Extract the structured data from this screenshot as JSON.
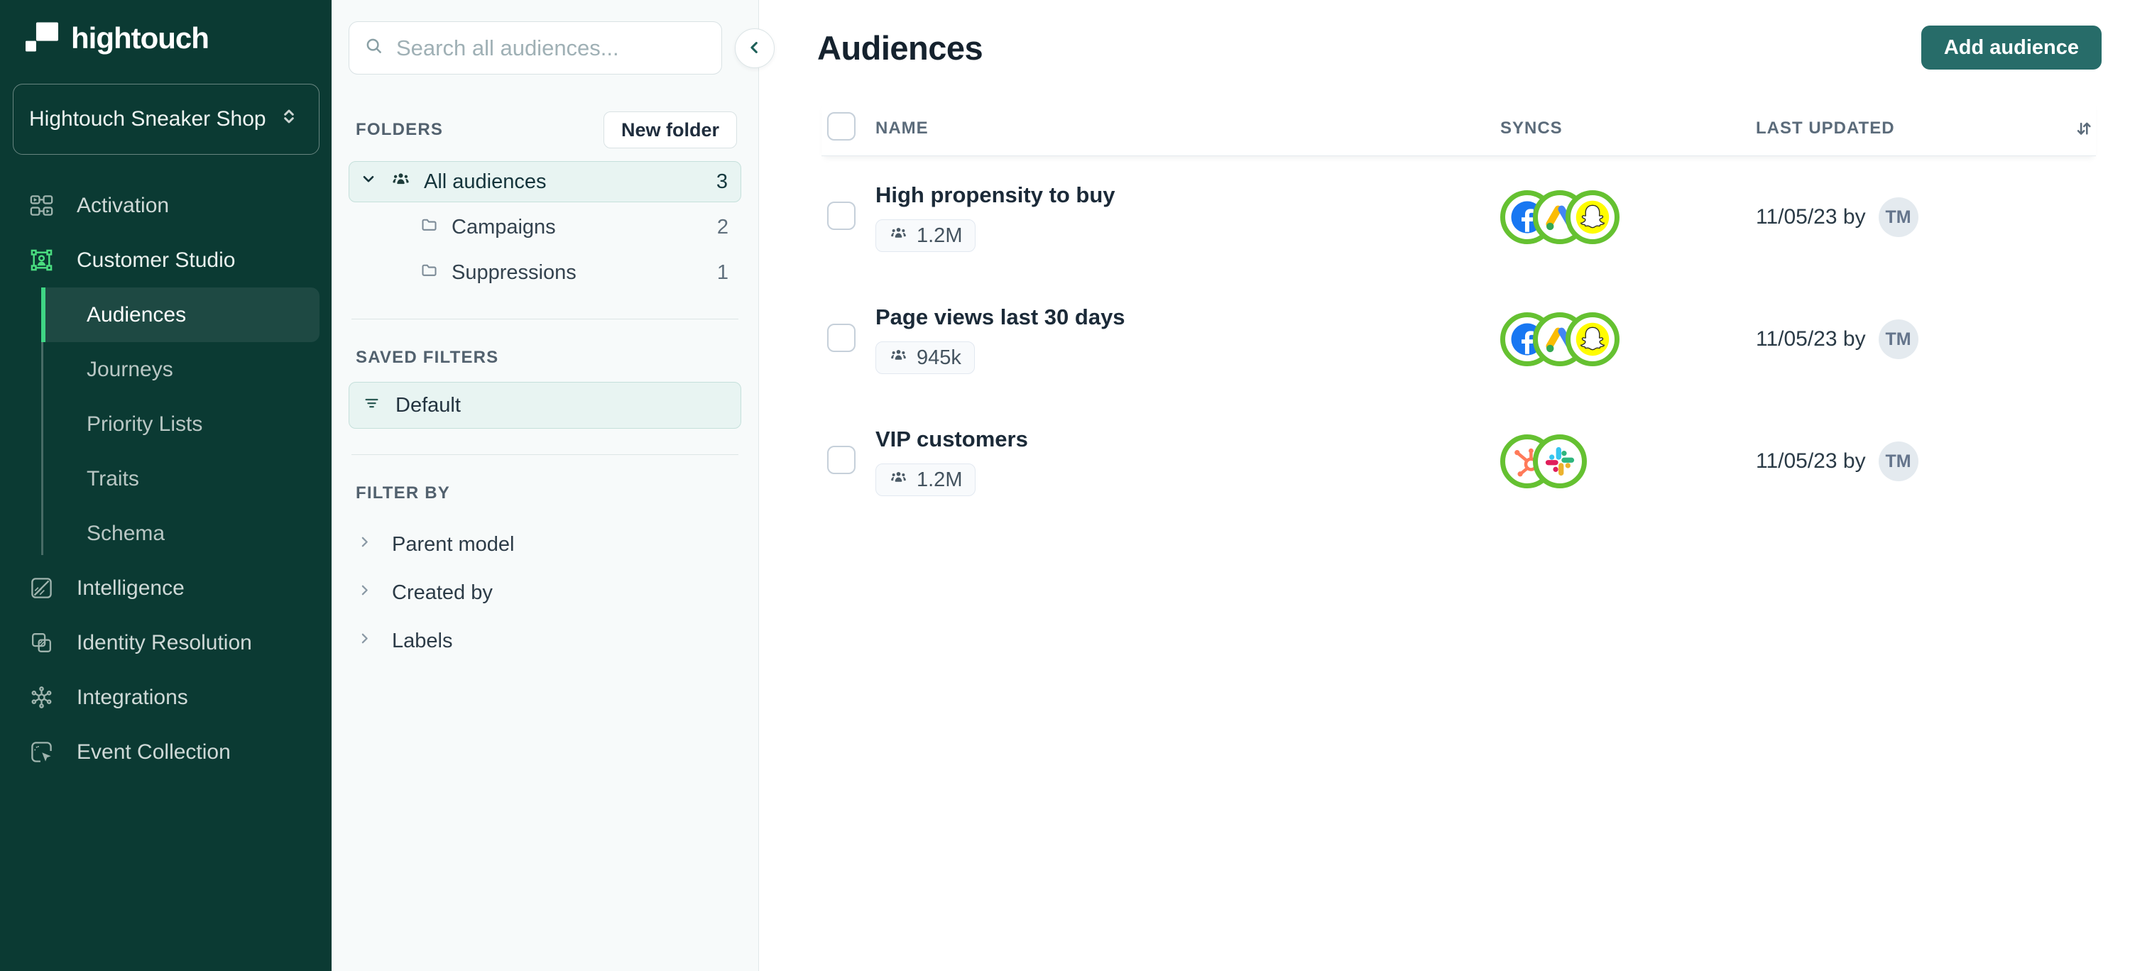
{
  "colors": {
    "sidebar_bg": "#0b3a33",
    "accent_green": "#3fd584",
    "customer_studio_icon_green": "#4ade80",
    "button_teal": "#276c69",
    "sync_ring_green": "#65c131",
    "selected_tint": "#e8f4f2",
    "facebook_blue": "#1877f2",
    "snapchat_yellow": "#fffc00",
    "hubspot_orange": "#ff7a59"
  },
  "icons": {
    "sidebar": [
      "activation-icon",
      "customer-studio-icon",
      "intelligence-icon",
      "identity-resolution-icon",
      "integrations-icon",
      "event-collection-icon"
    ],
    "panel": [
      "search-icon",
      "collapse-left-icon",
      "chevron-down-icon",
      "audiences-people-icon",
      "folder-icon",
      "filter-icon",
      "chevron-right-icon"
    ],
    "table": [
      "sort-icon",
      "users-icon",
      "checkbox"
    ],
    "syncs": [
      "facebook-icon",
      "google-ads-icon",
      "snapchat-icon",
      "hubspot-icon",
      "slack-icon"
    ]
  },
  "sidebar": {
    "logo": "hightouch",
    "workspace_name": "Hightouch Sneaker Shop",
    "items": [
      {
        "label": "Activation"
      },
      {
        "label": "Customer Studio"
      },
      {
        "label": "Audiences"
      },
      {
        "label": "Journeys"
      },
      {
        "label": "Priority Lists"
      },
      {
        "label": "Traits"
      },
      {
        "label": "Schema"
      },
      {
        "label": "Intelligence"
      },
      {
        "label": "Identity Resolution"
      },
      {
        "label": "Integrations"
      },
      {
        "label": "Event Collection"
      }
    ]
  },
  "folders_panel": {
    "search_placeholder": "Search all audiences...",
    "folders_title": "FOLDERS",
    "new_folder_label": "New folder",
    "tree": [
      {
        "label": "All audiences",
        "count": "3"
      },
      {
        "label": "Campaigns",
        "count": "2"
      },
      {
        "label": "Suppressions",
        "count": "1"
      }
    ],
    "saved_filters_title": "SAVED FILTERS",
    "saved_filters": [
      {
        "label": "Default"
      }
    ],
    "filter_by_title": "FILTER BY",
    "filter_groups": [
      {
        "label": "Parent model"
      },
      {
        "label": "Created by"
      },
      {
        "label": "Labels"
      }
    ]
  },
  "main": {
    "title": "Audiences",
    "add_button": "Add audience",
    "table": {
      "columns": [
        "NAME",
        "SYNCS",
        "LAST UPDATED"
      ],
      "rows": [
        {
          "name": "High propensity to buy",
          "size": "1.2M",
          "syncs": [
            "facebook",
            "google-ads",
            "snapchat"
          ],
          "updated": "11/05/23 by",
          "avatar": "TM"
        },
        {
          "name": "Page views last 30 days",
          "size": "945k",
          "syncs": [
            "facebook",
            "google-ads",
            "snapchat"
          ],
          "updated": "11/05/23 by",
          "avatar": "TM"
        },
        {
          "name": "VIP customers",
          "size": "1.2M",
          "syncs": [
            "hubspot",
            "slack"
          ],
          "updated": "11/05/23 by",
          "avatar": "TM"
        }
      ]
    }
  }
}
